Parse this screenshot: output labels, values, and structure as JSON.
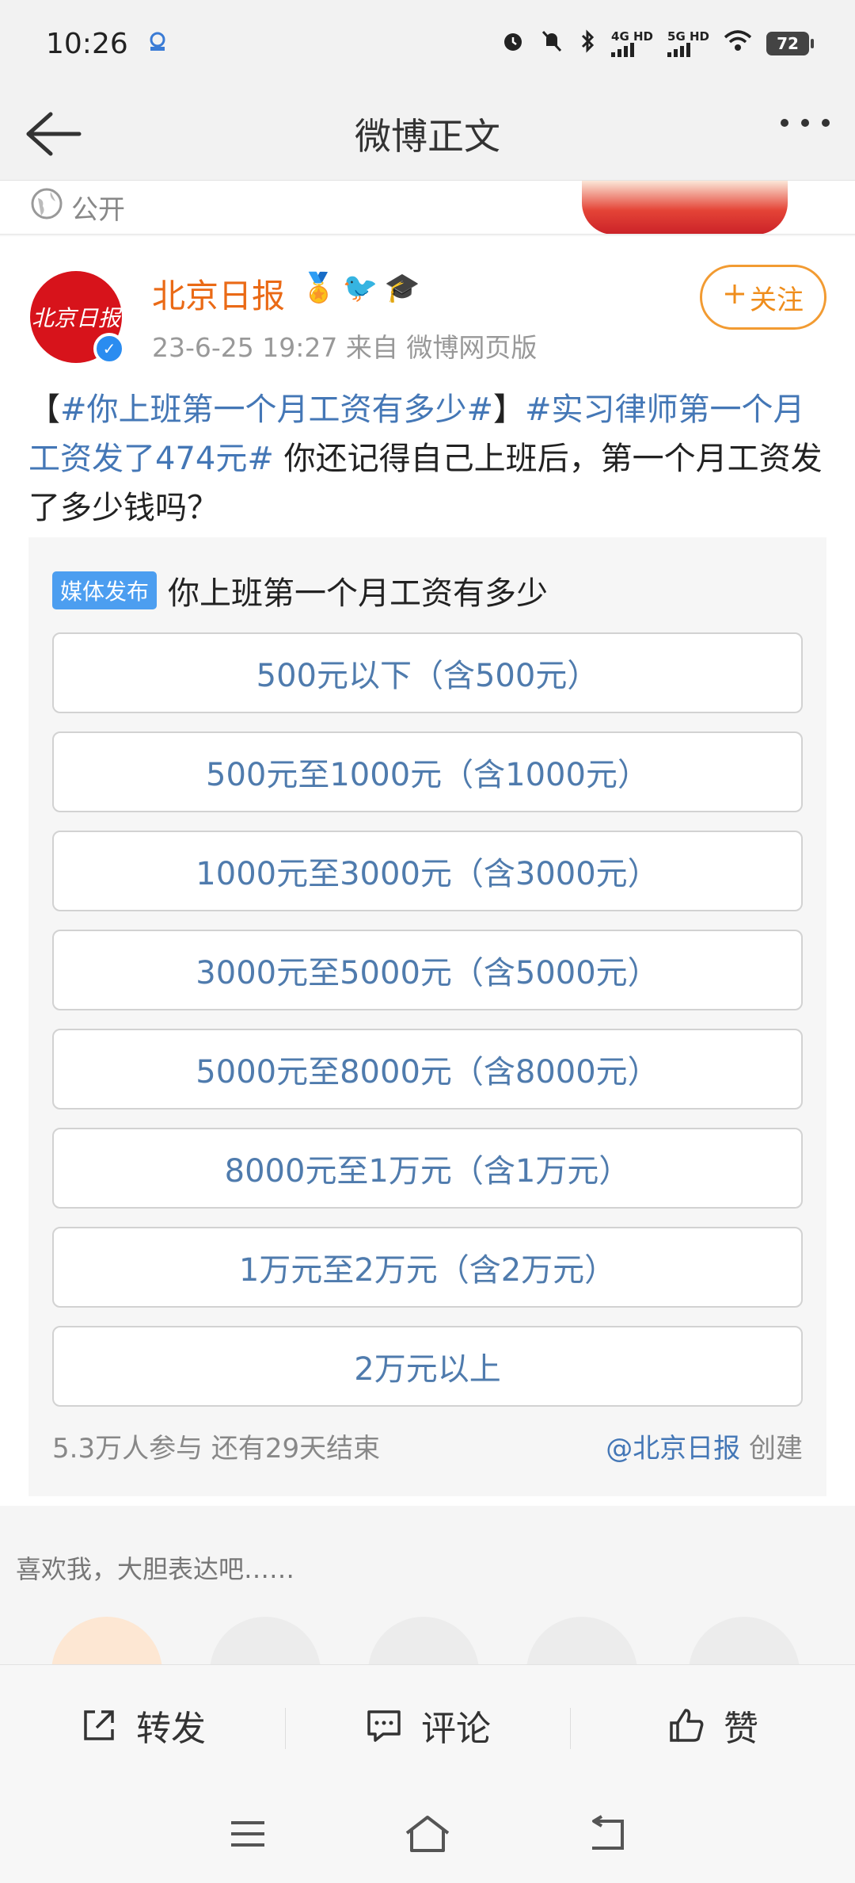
{
  "status_bar": {
    "time": "10:26",
    "net1": "4G HD",
    "net2": "5G HD",
    "battery": "72"
  },
  "nav": {
    "title": "微博正文"
  },
  "public_label": "公开",
  "post": {
    "author": "北京日报",
    "avatar_text": "北京日报",
    "meta": "23-6-25 19:27   来自 微博网页版",
    "follow_label": "关注",
    "text_parts": {
      "bracket_open": "【",
      "tag1": "#你上班第一个月工资有多少#",
      "bracket_close": "】",
      "tag2": "#实习律师第一个月工资发了474元#",
      "body": " 你还记得自己上班后，第一个月工资发了多少钱吗？"
    }
  },
  "poll": {
    "badge": "媒体发布",
    "title": "你上班第一个月工资有多少",
    "options": [
      "500元以下（含500元）",
      "500元至1000元（含1000元）",
      "1000元至3000元（含3000元）",
      "3000元至5000元（含5000元）",
      "5000元至8000元（含8000元）",
      "8000元至1万元（含1万元）",
      "1万元至2万元（含2万元）",
      "2万元以上"
    ],
    "stats": "5.3万人参与  还有29天结束",
    "creator_mention": "@北京日报",
    "creator_suffix": " 创建"
  },
  "comment_prompt": "喜欢我，大胆表达吧……",
  "actions": {
    "repost": "转发",
    "comment": "评论",
    "like": "赞"
  },
  "colors": {
    "accent_orange": "#ef8d1c",
    "link_blue": "#4477b6",
    "verified_blue": "#2a8cf0"
  }
}
